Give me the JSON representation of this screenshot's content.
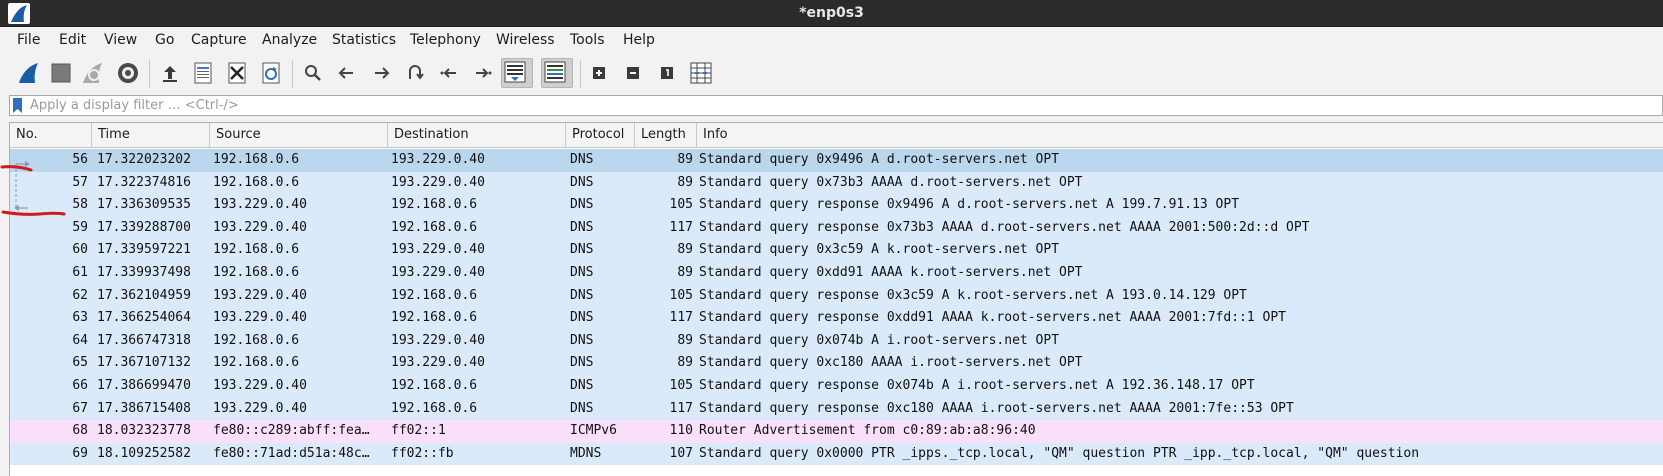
{
  "window": {
    "title": "*enp0s3"
  },
  "menu": [
    "File",
    "Edit",
    "View",
    "Go",
    "Capture",
    "Analyze",
    "Statistics",
    "Telephony",
    "Wireless",
    "Tools",
    "Help"
  ],
  "toolbar": {
    "buttons": [
      "start-capture-icon",
      "stop-capture-icon",
      "restart-capture-icon",
      "capture-options-icon",
      "open-file-icon",
      "save-file-icon",
      "close-file-icon",
      "reload-file-icon",
      "find-packet-icon",
      "go-back-icon",
      "go-forward-icon",
      "go-to-packet-icon",
      "go-first-packet-icon",
      "go-last-packet-icon",
      "auto-scroll-icon",
      "colorize-icon",
      "zoom-in-icon",
      "zoom-out-icon",
      "normal-size-icon",
      "resize-columns-icon"
    ]
  },
  "filter": {
    "placeholder": "Apply a display filter … <Ctrl-/>"
  },
  "columns": [
    "No.",
    "Time",
    "Source",
    "Destination",
    "Protocol",
    "Length",
    "Info"
  ],
  "packets": [
    {
      "no": "56",
      "time": "17.322023202",
      "src": "192.168.0.6",
      "dst": "193.229.0.40",
      "proto": "DNS",
      "len": "89",
      "info": "Standard query 0x9496 A d.root-servers.net OPT",
      "type": "selected"
    },
    {
      "no": "57",
      "time": "17.322374816",
      "src": "192.168.0.6",
      "dst": "193.229.0.40",
      "proto": "DNS",
      "len": "89",
      "info": "Standard query 0x73b3 AAAA d.root-servers.net OPT",
      "type": "dns"
    },
    {
      "no": "58",
      "time": "17.336309535",
      "src": "193.229.0.40",
      "dst": "192.168.0.6",
      "proto": "DNS",
      "len": "105",
      "info": "Standard query response 0x9496 A d.root-servers.net A 199.7.91.13 OPT",
      "type": "dns"
    },
    {
      "no": "59",
      "time": "17.339288700",
      "src": "193.229.0.40",
      "dst": "192.168.0.6",
      "proto": "DNS",
      "len": "117",
      "info": "Standard query response 0x73b3 AAAA d.root-servers.net AAAA 2001:500:2d::d OPT",
      "type": "dns"
    },
    {
      "no": "60",
      "time": "17.339597221",
      "src": "192.168.0.6",
      "dst": "193.229.0.40",
      "proto": "DNS",
      "len": "89",
      "info": "Standard query 0x3c59 A k.root-servers.net OPT",
      "type": "dns"
    },
    {
      "no": "61",
      "time": "17.339937498",
      "src": "192.168.0.6",
      "dst": "193.229.0.40",
      "proto": "DNS",
      "len": "89",
      "info": "Standard query 0xdd91 AAAA k.root-servers.net OPT",
      "type": "dns"
    },
    {
      "no": "62",
      "time": "17.362104959",
      "src": "193.229.0.40",
      "dst": "192.168.0.6",
      "proto": "DNS",
      "len": "105",
      "info": "Standard query response 0x3c59 A k.root-servers.net A 193.0.14.129 OPT",
      "type": "dns"
    },
    {
      "no": "63",
      "time": "17.366254064",
      "src": "193.229.0.40",
      "dst": "192.168.0.6",
      "proto": "DNS",
      "len": "117",
      "info": "Standard query response 0xdd91 AAAA k.root-servers.net AAAA 2001:7fd::1 OPT",
      "type": "dns"
    },
    {
      "no": "64",
      "time": "17.366747318",
      "src": "192.168.0.6",
      "dst": "193.229.0.40",
      "proto": "DNS",
      "len": "89",
      "info": "Standard query 0x074b A i.root-servers.net OPT",
      "type": "dns"
    },
    {
      "no": "65",
      "time": "17.367107132",
      "src": "192.168.0.6",
      "dst": "193.229.0.40",
      "proto": "DNS",
      "len": "89",
      "info": "Standard query 0xc180 AAAA i.root-servers.net OPT",
      "type": "dns"
    },
    {
      "no": "66",
      "time": "17.386699470",
      "src": "193.229.0.40",
      "dst": "192.168.0.6",
      "proto": "DNS",
      "len": "105",
      "info": "Standard query response 0x074b A i.root-servers.net A 192.36.148.17 OPT",
      "type": "dns"
    },
    {
      "no": "67",
      "time": "17.386715408",
      "src": "193.229.0.40",
      "dst": "192.168.0.6",
      "proto": "DNS",
      "len": "117",
      "info": "Standard query response 0xc180 AAAA i.root-servers.net AAAA 2001:7fe::53 OPT",
      "type": "dns"
    },
    {
      "no": "68",
      "time": "18.032323778",
      "src": "fe80::c289:abff:fea…",
      "dst": "ff02::1",
      "proto": "ICMPv6",
      "len": "110",
      "info": "Router Advertisement from c0:89:ab:a8:96:40",
      "type": "icmp"
    },
    {
      "no": "69",
      "time": "18.109252582",
      "src": "fe80::71ad:d51a:48c…",
      "dst": "ff02::fb",
      "proto": "MDNS",
      "len": "107",
      "info": "Standard query 0x0000 PTR _ipps._tcp.local, \"QM\" question PTR _ipp._tcp.local, \"QM\" question",
      "type": "mdns"
    }
  ],
  "colors": {
    "dns": "#dbeafa",
    "selected": "#bbd7ee",
    "icmp": "#fbe0fb",
    "annotation": "#d11b1b"
  }
}
